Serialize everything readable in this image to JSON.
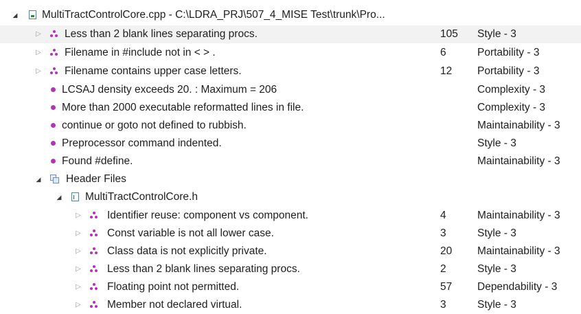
{
  "tree": {
    "root": {
      "label": "MultiTractControlCore.cpp - C:\\LDRA_PRJ\\507_4_MISE Test\\trunk\\Pro..."
    },
    "cpp_groups": [
      {
        "label": "Less than 2 blank lines separating procs.",
        "count": "105",
        "category": "Style - 3"
      },
      {
        "label": "Filename in #include not in < > .",
        "count": "6",
        "category": "Portability - 3"
      },
      {
        "label": "Filename contains upper case letters.",
        "count": "12",
        "category": "Portability - 3"
      }
    ],
    "cpp_items": [
      {
        "label": "LCSAJ density exceeds 20. : Maximum = 206",
        "category": "Complexity - 3"
      },
      {
        "label": "More than 2000 executable reformatted lines in file.",
        "category": "Complexity - 3"
      },
      {
        "label": "continue or goto not defined to rubbish.",
        "category": "Maintainability - 3"
      },
      {
        "label": "Preprocessor command indented.",
        "category": "Style - 3"
      },
      {
        "label": "Found #define.",
        "category": "Maintainability - 3"
      }
    ],
    "header_folder": {
      "label": "Header Files"
    },
    "header_file": {
      "label": "MultiTractControlCore.h"
    },
    "h_groups": [
      {
        "label": "Identifier reuse: component vs component.",
        "count": "4",
        "category": "Maintainability - 3"
      },
      {
        "label": "Const variable is not all lower case.",
        "count": "3",
        "category": "Style - 3"
      },
      {
        "label": "Class data is not explicitly private.",
        "count": "20",
        "category": "Maintainability - 3"
      },
      {
        "label": "Less than 2 blank lines separating procs.",
        "count": "2",
        "category": "Style - 3"
      },
      {
        "label": "Floating point not permitted.",
        "count": "57",
        "category": "Dependability - 3"
      },
      {
        "label": "Member not declared virtual.",
        "count": "3",
        "category": "Style - 3"
      }
    ],
    "colors": {
      "violation_dot": "#b233b8",
      "selected_row": "#f2f2f2"
    },
    "icons": {
      "expanded": "triangle-down-icon",
      "collapsed": "triangle-right-icon",
      "violation_group": "violation-group-icon",
      "violation": "violation-dot-icon",
      "source_file": "cpp-file-icon",
      "header_folder": "header-folder-icon",
      "header_file": "header-file-icon"
    }
  }
}
